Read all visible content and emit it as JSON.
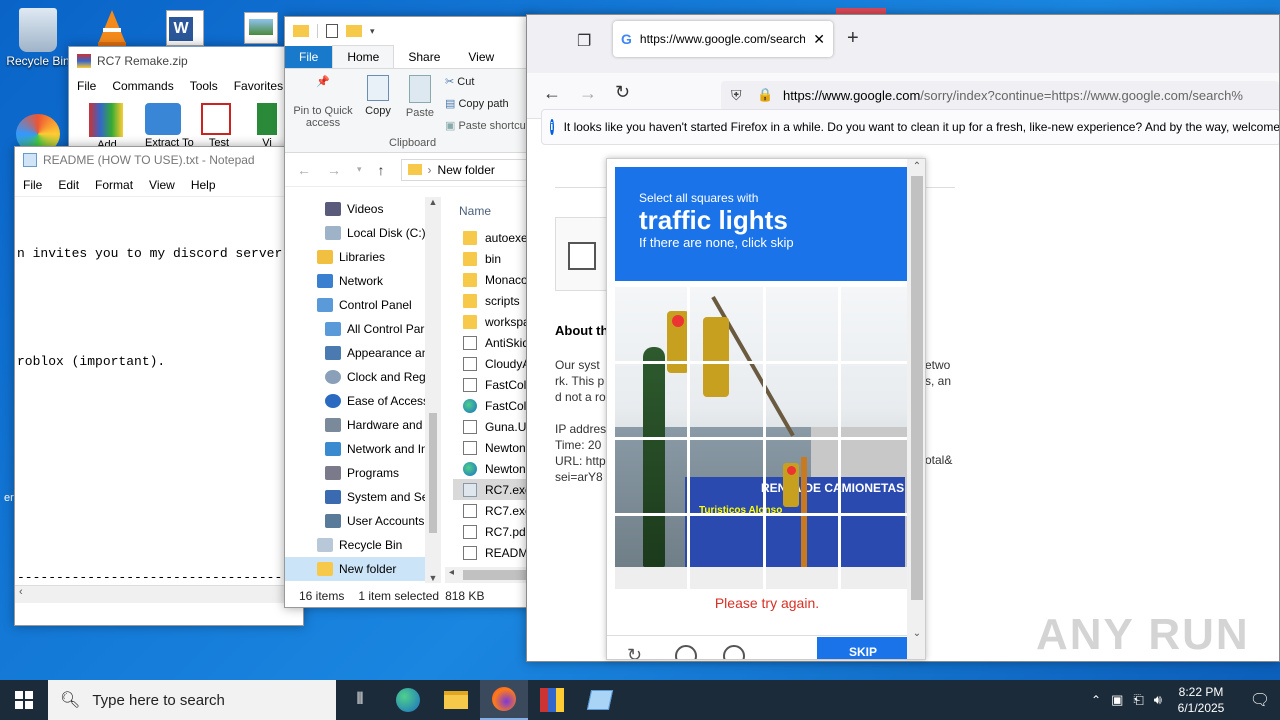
{
  "desktop": {
    "icons": [
      {
        "label": "Recycle Bin",
        "icon": "recycle-bin-icon"
      },
      {
        "label": "",
        "icon": "vlc-icon"
      },
      {
        "label": "",
        "icon": "word-icon"
      },
      {
        "label": "",
        "icon": "image-file-icon"
      },
      {
        "label": "",
        "icon": "browser-icon"
      }
    ],
    "edge_text": "er"
  },
  "rc7_window": {
    "title": "RC7 Remake.zip",
    "menu": [
      "File",
      "Commands",
      "Tools",
      "Favorites"
    ],
    "toolbar": [
      "Add",
      "Extract To",
      "Test",
      "Vi"
    ]
  },
  "notepad": {
    "title": "README (HOW TO USE).txt - Notepad",
    "menu": [
      "File",
      "Edit",
      "Format",
      "View",
      "Help"
    ],
    "lines": [
      "n invites you to my discord server",
      "",
      "roblox (important).",
      "",
      "",
      "",
      "-----------------------------------"
    ]
  },
  "explorer": {
    "qat": [
      "folder-icon",
      "properties-icon",
      "new-folder-icon",
      "dropdown-icon"
    ],
    "ribbon_tabs": [
      "File",
      "Home",
      "Share",
      "View"
    ],
    "ribbon": {
      "pin_label": "Pin to Quick access",
      "copy_label": "Copy",
      "paste_label": "Paste",
      "cut_label": "Cut",
      "copy_path_label": "Copy path",
      "paste_shortcut_label": "Paste shortcut",
      "group_label": "Clipboard"
    },
    "address": "New folder",
    "nav_items": [
      "Videos",
      "Local Disk (C:)",
      "Libraries",
      "Network",
      "Control Panel",
      "All Control Par",
      "Appearance an",
      "Clock and Regi",
      "Ease of Access",
      "Hardware and",
      "Network and In",
      "Programs",
      "System and Se",
      "User Accounts",
      "Recycle Bin",
      "New folder"
    ],
    "column_name": "Name",
    "files": [
      {
        "name": "autoexec",
        "kind": "folder"
      },
      {
        "name": "bin",
        "kind": "folder"
      },
      {
        "name": "Monaco",
        "kind": "folder"
      },
      {
        "name": "scripts",
        "kind": "folder"
      },
      {
        "name": "workspac",
        "kind": "folder"
      },
      {
        "name": "AntiSkid",
        "kind": "dll"
      },
      {
        "name": "CloudyA",
        "kind": "dll"
      },
      {
        "name": "FastColo",
        "kind": "dll"
      },
      {
        "name": "FastColo",
        "kind": "edge"
      },
      {
        "name": "Guna.UI2",
        "kind": "dll"
      },
      {
        "name": "Newtons",
        "kind": "dll"
      },
      {
        "name": "Newtons",
        "kind": "edge"
      },
      {
        "name": "RC7.exe",
        "kind": "exe"
      },
      {
        "name": "RC7.exe.",
        "kind": "doc"
      },
      {
        "name": "RC7.pdb",
        "kind": "doc"
      },
      {
        "name": "README",
        "kind": "txt"
      }
    ],
    "status": {
      "count": "16 items",
      "selected": "1 item selected",
      "size": "818 KB"
    }
  },
  "firefox": {
    "tab_title": "https://www.google.com/search",
    "url_host": "https://www.google.com",
    "url_rest": "/sorry/index?continue=https://www.google.com/search%",
    "notification": "It looks like you haven't started Firefox in a while. Do you want to clean it up for a fresh, like-new experience? And by the way, welcome",
    "page": {
      "about_heading": "About th",
      "para_left": [
        "Our syst",
        "rk. This p",
        "d not a ro"
      ],
      "para_right": [
        "etwo",
        "s, an",
        ""
      ],
      "ip_line": "IP addres",
      "time_line": "Time: 20",
      "url_line": "URL: http",
      "url_right": "otal&",
      "sei_line": "sei=arY8"
    }
  },
  "captcha": {
    "instruction": "Select all squares with",
    "target": "traffic lights",
    "hint": "If there are none, click skip",
    "error": "Please try again.",
    "skip_label": "SKIP",
    "sign_text": "RENTA DE CAMIONETAS",
    "sign_sub": "Turisticos Alonso"
  },
  "taskbar": {
    "search_placeholder": "Type here to search",
    "time": "8:22 PM",
    "date": "6/1/2025"
  },
  "watermark": "ANY RUN"
}
